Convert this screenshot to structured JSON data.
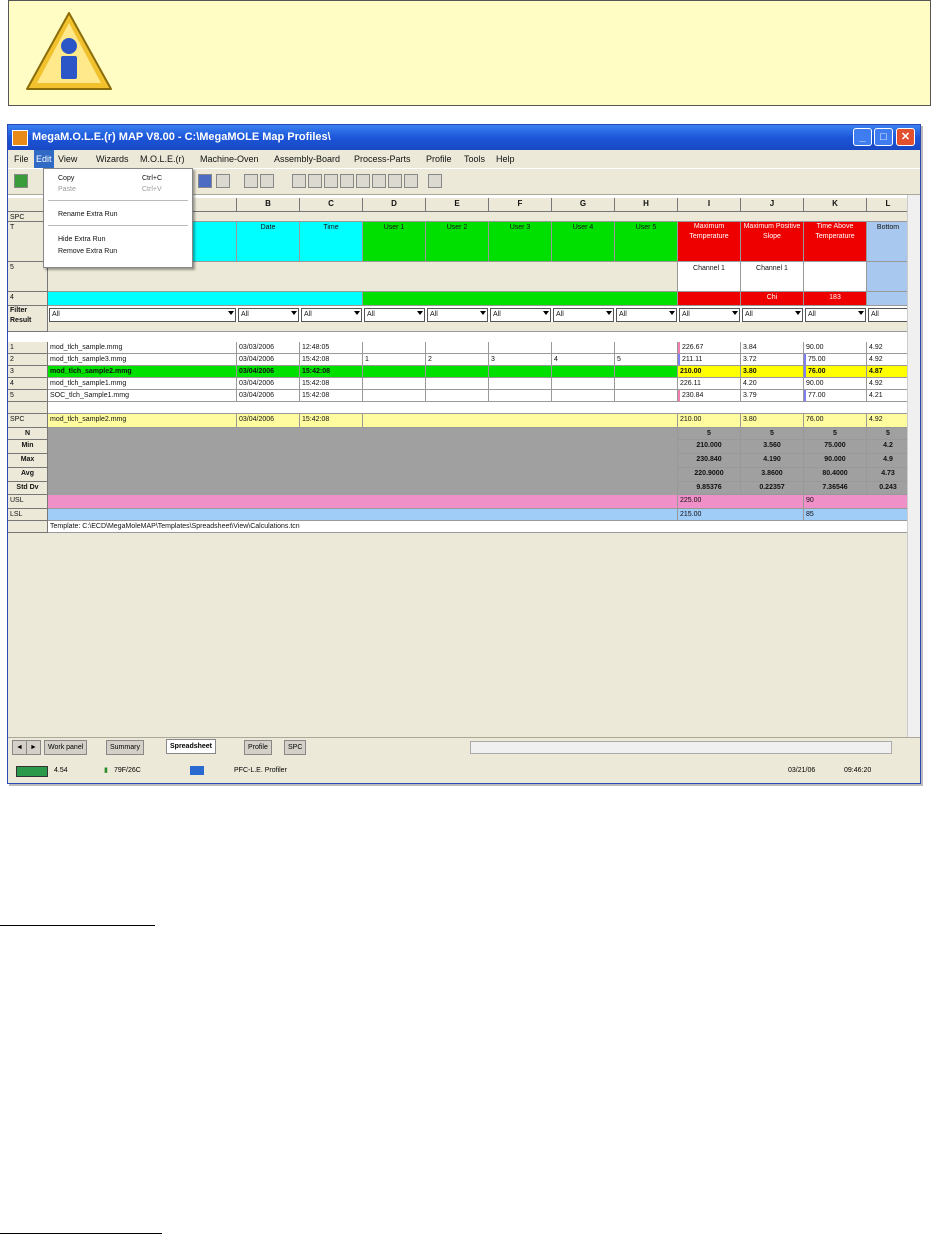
{
  "window": {
    "title": "MegaM.O.L.E.(r) MAP V8.00 - C:\\MegaMOLE Map Profiles\\",
    "buttons": {
      "minimize": "_",
      "maximize": "□",
      "close": "✕"
    }
  },
  "menubar": [
    "File",
    "Edit",
    "View",
    "Wizards",
    "M.O.L.E.(r)",
    "Machine-Oven",
    "Assembly-Board",
    "Process-Parts",
    "Profile",
    "Tools",
    "Help"
  ],
  "edit_menu": {
    "copy": "Copy",
    "copy_sc": "Ctrl+C",
    "paste": "Paste",
    "paste_sc": "Ctrl+V",
    "rename": "Rename Extra Run",
    "hide": "Hide Extra Run",
    "remove": "Remove Extra Run"
  },
  "columns": [
    "B",
    "C",
    "D",
    "E",
    "F",
    "G",
    "H",
    "I",
    "J",
    "K",
    "L"
  ],
  "row_headers": {
    "spc": "SPC",
    "title_row": "T",
    "five": "5",
    "four": "4",
    "filter": "Filter Result",
    "r1": "1",
    "r2": "2",
    "r3": "3",
    "r4": "4",
    "r5": "5",
    "spc2": "SPC",
    "n": "N",
    "min": "Min",
    "max": "Max",
    "avg": "Avg",
    "std": "Std Dv",
    "usl": "USL",
    "lsl": "LSL"
  },
  "header_labels": {
    "date": "Date",
    "time": "Time",
    "user1": "User 1",
    "user2": "User 2",
    "user3": "User 3",
    "user4": "User 4",
    "user5": "User 5",
    "i": "Maximum Temperature",
    "j": "Maximum Positive Slope",
    "k": "Time Above Temperature",
    "l": "Bottom"
  },
  "channel_labels": {
    "i": "Channel 1",
    "j": "Channel 1"
  },
  "red_row": {
    "j": "Chi",
    "k": "183"
  },
  "filter_value": "All",
  "rows": [
    {
      "name": "mod_tlch_sample.mmg",
      "date": "03/03/2006",
      "time": "12:48:05",
      "u": [
        "",
        "",
        "",
        "",
        ""
      ],
      "i": "226.67",
      "j": "3.84",
      "k": "90.00",
      "l": "4.92"
    },
    {
      "name": "mod_tlch_sample3.mmg",
      "date": "03/04/2006",
      "time": "15:42:08",
      "u": [
        "1",
        "2",
        "3",
        "4",
        "5"
      ],
      "i": "211.11",
      "j": "3.72",
      "k": "75.00",
      "l": "4.92"
    },
    {
      "name": "mod_tlch_sample2.mmg",
      "date": "03/04/2006",
      "time": "15:42:08",
      "u": [
        "",
        "",
        "",
        "",
        ""
      ],
      "i": "210.00",
      "j": "3.80",
      "k": "76.00",
      "l": "4.87"
    },
    {
      "name": "mod_tlch_sample1.mmg",
      "date": "03/04/2006",
      "time": "15:42:08",
      "u": [
        "",
        "",
        "",
        "",
        ""
      ],
      "i": "226.11",
      "j": "4.20",
      "k": "90.00",
      "l": "4.92"
    },
    {
      "name": "SOC_tlch_Sample1.mmg",
      "date": "03/04/2006",
      "time": "15:42:08",
      "u": [
        "",
        "",
        "",
        "",
        ""
      ],
      "i": "230.84",
      "j": "3.79",
      "k": "77.00",
      "l": "4.21"
    }
  ],
  "spc_row": {
    "name": "mod_tlch_sample2.mmg",
    "date": "03/04/2006",
    "time": "15:42:08",
    "i": "210.00",
    "j": "3.80",
    "k": "76.00",
    "l": "4.92"
  },
  "stats": {
    "n": [
      "5",
      "5",
      "5",
      "5"
    ],
    "min": [
      "210.000",
      "3.560",
      "75.000",
      "4.2"
    ],
    "max": [
      "230.840",
      "4.190",
      "90.000",
      "4.9"
    ],
    "avg": [
      "220.9000",
      "3.8600",
      "80.4000",
      "4.73"
    ],
    "std": [
      "9.85376",
      "0.22357",
      "7.36546",
      "0.243"
    ]
  },
  "usl": {
    "i": "225.00",
    "k": "90"
  },
  "lsl": {
    "i": "215.00",
    "k": "85"
  },
  "template_row": "Template: C:\\ECD\\MegaMoleMAP\\Templates\\Spreadsheet\\View\\Calculations.tcn",
  "tabs": [
    "Work panel",
    "Summary",
    "Spreadsheet",
    "Profile",
    "SPC"
  ],
  "status": {
    "battery": "4.54",
    "temp": "79F/26C",
    "profile": "PFC-L.E. Profiler",
    "date": "03/21/06",
    "time": "09:46:20"
  }
}
